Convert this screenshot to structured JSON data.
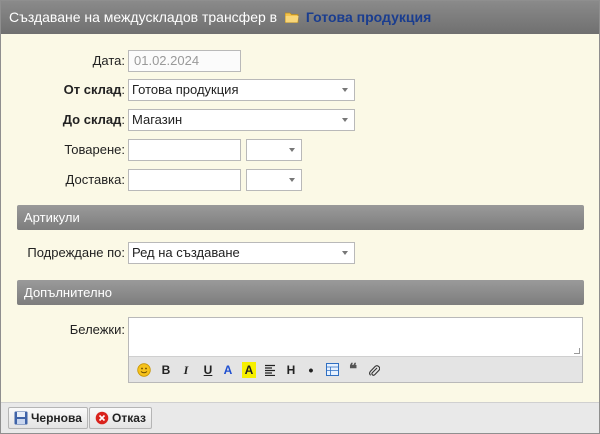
{
  "title": {
    "prefix": "Създаване на междускладов трансфер в",
    "store_link": "Готова продукция"
  },
  "form": {
    "date": {
      "label": "Дата",
      "value": "01.02.2024"
    },
    "from_store": {
      "label": "От склад",
      "value": "Готова продукция"
    },
    "to_store": {
      "label": "До склад",
      "value": "Магазин"
    },
    "loading": {
      "label": "Товарене",
      "value": "",
      "time": ""
    },
    "delivery": {
      "label": "Доставка",
      "value": "",
      "time": ""
    }
  },
  "sections": {
    "articles": "Артикули",
    "additional": "Допълнително"
  },
  "ordering": {
    "label": "Подреждане по:",
    "value": "Ред на създаване"
  },
  "notes": {
    "label": "Бележки:",
    "value": ""
  },
  "editor_toolbar": [
    "smiley-icon",
    "B",
    "I",
    "U",
    "A",
    "A",
    "align-icon",
    "H",
    "•",
    "table-icon",
    "quote-icon",
    "attach-icon"
  ],
  "footer": {
    "draft_label": "Чернова",
    "cancel_label": "Отказ"
  }
}
